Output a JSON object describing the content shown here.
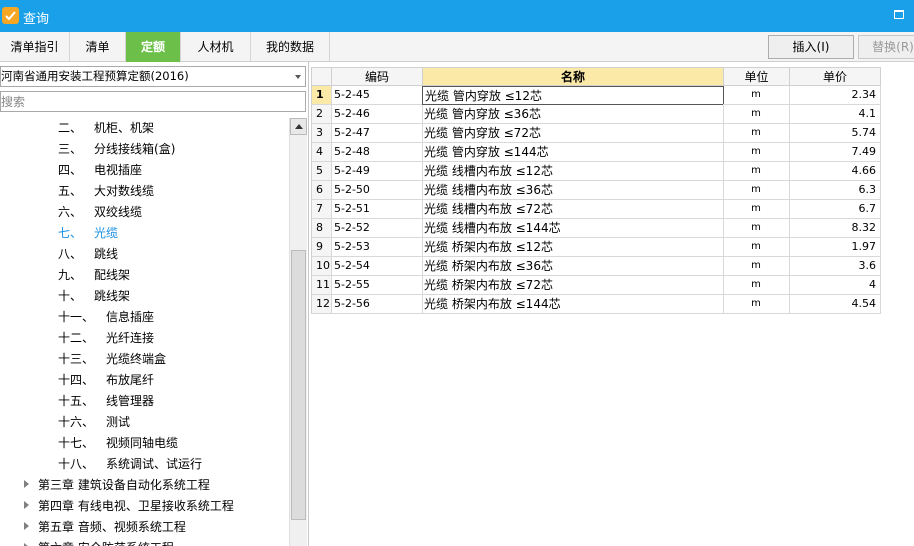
{
  "window": {
    "title": "查询"
  },
  "tabs": [
    {
      "label": "清单指引"
    },
    {
      "label": "清单"
    },
    {
      "label": "定额",
      "active": true
    },
    {
      "label": "人材机"
    },
    {
      "label": "我的数据"
    }
  ],
  "toolbar": {
    "insert_label": "插入(I)",
    "replace_label": "替换(R)"
  },
  "left": {
    "norm_library": "河南省通用安装工程预算定额(2016)",
    "search_placeholder": "搜索",
    "tree_items": [
      {
        "ord": "二、",
        "name": "机柜、机架"
      },
      {
        "ord": "三、",
        "name": "分线接线箱(盒)"
      },
      {
        "ord": "四、",
        "name": "电视插座"
      },
      {
        "ord": "五、",
        "name": "大对数线缆"
      },
      {
        "ord": "六、",
        "name": "双绞线缆"
      },
      {
        "ord": "七、",
        "name": "光缆",
        "selected": true
      },
      {
        "ord": "八、",
        "name": "跳线"
      },
      {
        "ord": "九、",
        "name": "配线架"
      },
      {
        "ord": "十、",
        "name": "跳线架"
      },
      {
        "ord": "十一、",
        "name": "信息插座"
      },
      {
        "ord": "十二、",
        "name": "光纤连接"
      },
      {
        "ord": "十三、",
        "name": "光缆终端盒"
      },
      {
        "ord": "十四、",
        "name": "布放尾纤"
      },
      {
        "ord": "十五、",
        "name": "线管理器"
      },
      {
        "ord": "十六、",
        "name": "测试"
      },
      {
        "ord": "十七、",
        "name": "视频同轴电缆"
      },
      {
        "ord": "十八、",
        "name": "系统调试、试运行"
      }
    ],
    "chapters": [
      {
        "label": "第三章 建筑设备自动化系统工程"
      },
      {
        "label": "第四章 有线电视、卫星接收系统工程"
      },
      {
        "label": "第五章 音频、视频系统工程"
      },
      {
        "label": "第六章 安全防范系统工程"
      }
    ]
  },
  "table": {
    "headers": [
      "编码",
      "名称",
      "单位",
      "单价"
    ],
    "rows": [
      {
        "num": "1",
        "code": "5-2-45",
        "name": "光缆 管内穿放 ≤12芯",
        "unit": "m",
        "price": "2.34"
      },
      {
        "num": "2",
        "code": "5-2-46",
        "name": "光缆 管内穿放 ≤36芯",
        "unit": "m",
        "price": "4.1"
      },
      {
        "num": "3",
        "code": "5-2-47",
        "name": "光缆 管内穿放 ≤72芯",
        "unit": "m",
        "price": "5.74"
      },
      {
        "num": "4",
        "code": "5-2-48",
        "name": "光缆 管内穿放 ≤144芯",
        "unit": "m",
        "price": "7.49"
      },
      {
        "num": "5",
        "code": "5-2-49",
        "name": "光缆 线槽内布放 ≤12芯",
        "unit": "m",
        "price": "4.66"
      },
      {
        "num": "6",
        "code": "5-2-50",
        "name": "光缆 线槽内布放 ≤36芯",
        "unit": "m",
        "price": "6.3"
      },
      {
        "num": "7",
        "code": "5-2-51",
        "name": "光缆 线槽内布放 ≤72芯",
        "unit": "m",
        "price": "6.7"
      },
      {
        "num": "8",
        "code": "5-2-52",
        "name": "光缆 线槽内布放 ≤144芯",
        "unit": "m",
        "price": "8.32"
      },
      {
        "num": "9",
        "code": "5-2-53",
        "name": "光缆 桥架内布放 ≤12芯",
        "unit": "m",
        "price": "1.97"
      },
      {
        "num": "10",
        "code": "5-2-54",
        "name": "光缆 桥架内布放 ≤36芯",
        "unit": "m",
        "price": "3.6"
      },
      {
        "num": "11",
        "code": "5-2-55",
        "name": "光缆 桥架内布放 ≤72芯",
        "unit": "m",
        "price": "4"
      },
      {
        "num": "12",
        "code": "5-2-56",
        "name": "光缆 桥架内布放 ≤144芯",
        "unit": "m",
        "price": "4.54"
      }
    ]
  },
  "colors": {
    "titlebar": "#1aa0e8",
    "active_tab": "#6cc04a",
    "selected_node": "#1a8fe0",
    "header_highlight": "#fbe9a8"
  }
}
